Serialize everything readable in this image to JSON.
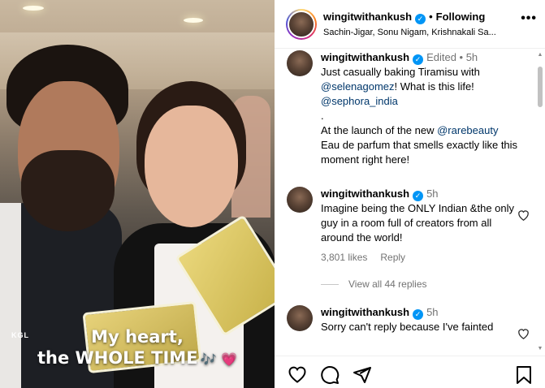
{
  "media": {
    "caption_line1": "My heart,",
    "caption_line2": "the WHOLE TIME",
    "caption_emoji": "🎶 💗",
    "apron_text": "KGL"
  },
  "header": {
    "username": "wingitwithankush",
    "separator": "•",
    "follow_label": "Following",
    "audio": "Sachin-Jigar, Sonu Nigam, Krishnakali Sa...",
    "more_label": "•••"
  },
  "caption_post": {
    "username": "wingitwithankush",
    "meta": "Edited • 5h",
    "line1": "Just casually baking Tiramisu with",
    "mention1": "@selenagomez",
    "line1b": "! What is this life!",
    "mention2": "@sephora_india",
    "dot": ".",
    "line2": "At the launch of the new ",
    "mention3": "@rarebeauty",
    "line3": "Eau de parfum that smells exactly like this moment right here!"
  },
  "comments": [
    {
      "username": "wingitwithankush",
      "time": "5h",
      "text": "Imagine being the ONLY Indian &the only guy in a room full of creators from all around the world!",
      "likes": "3,801 likes",
      "reply": "Reply",
      "view_all": "View all 44 replies"
    },
    {
      "username": "wingitwithankush",
      "time": "5h",
      "text": "Sorry can't reply because I've fainted"
    }
  ],
  "colors": {
    "verified": "#0095f6",
    "mention": "#00376b",
    "meta": "#737373"
  },
  "icons": [
    "heart-icon",
    "comment-icon",
    "share-icon",
    "bookmark-icon",
    "verified-icon",
    "more-icon"
  ]
}
